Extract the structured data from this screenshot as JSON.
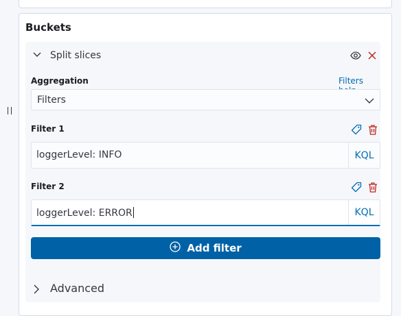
{
  "buckets": {
    "title": "Buckets",
    "aggregation_item": {
      "title": "Split slices",
      "aggregation_label": "Aggregation",
      "help_link": "Filters help",
      "aggregation_value": "Filters",
      "filters": [
        {
          "label": "Filter 1",
          "value": "loggerLevel: INFO",
          "query_language": "KQL"
        },
        {
          "label": "Filter 2",
          "value": "loggerLevel: ERROR",
          "query_language": "KQL"
        }
      ],
      "add_filter_label": "Add filter",
      "advanced_label": "Advanced"
    }
  },
  "colors": {
    "primary": "#0061a6",
    "link": "#006bb8",
    "danger": "#bd271e",
    "border": "#dfe3eb"
  }
}
